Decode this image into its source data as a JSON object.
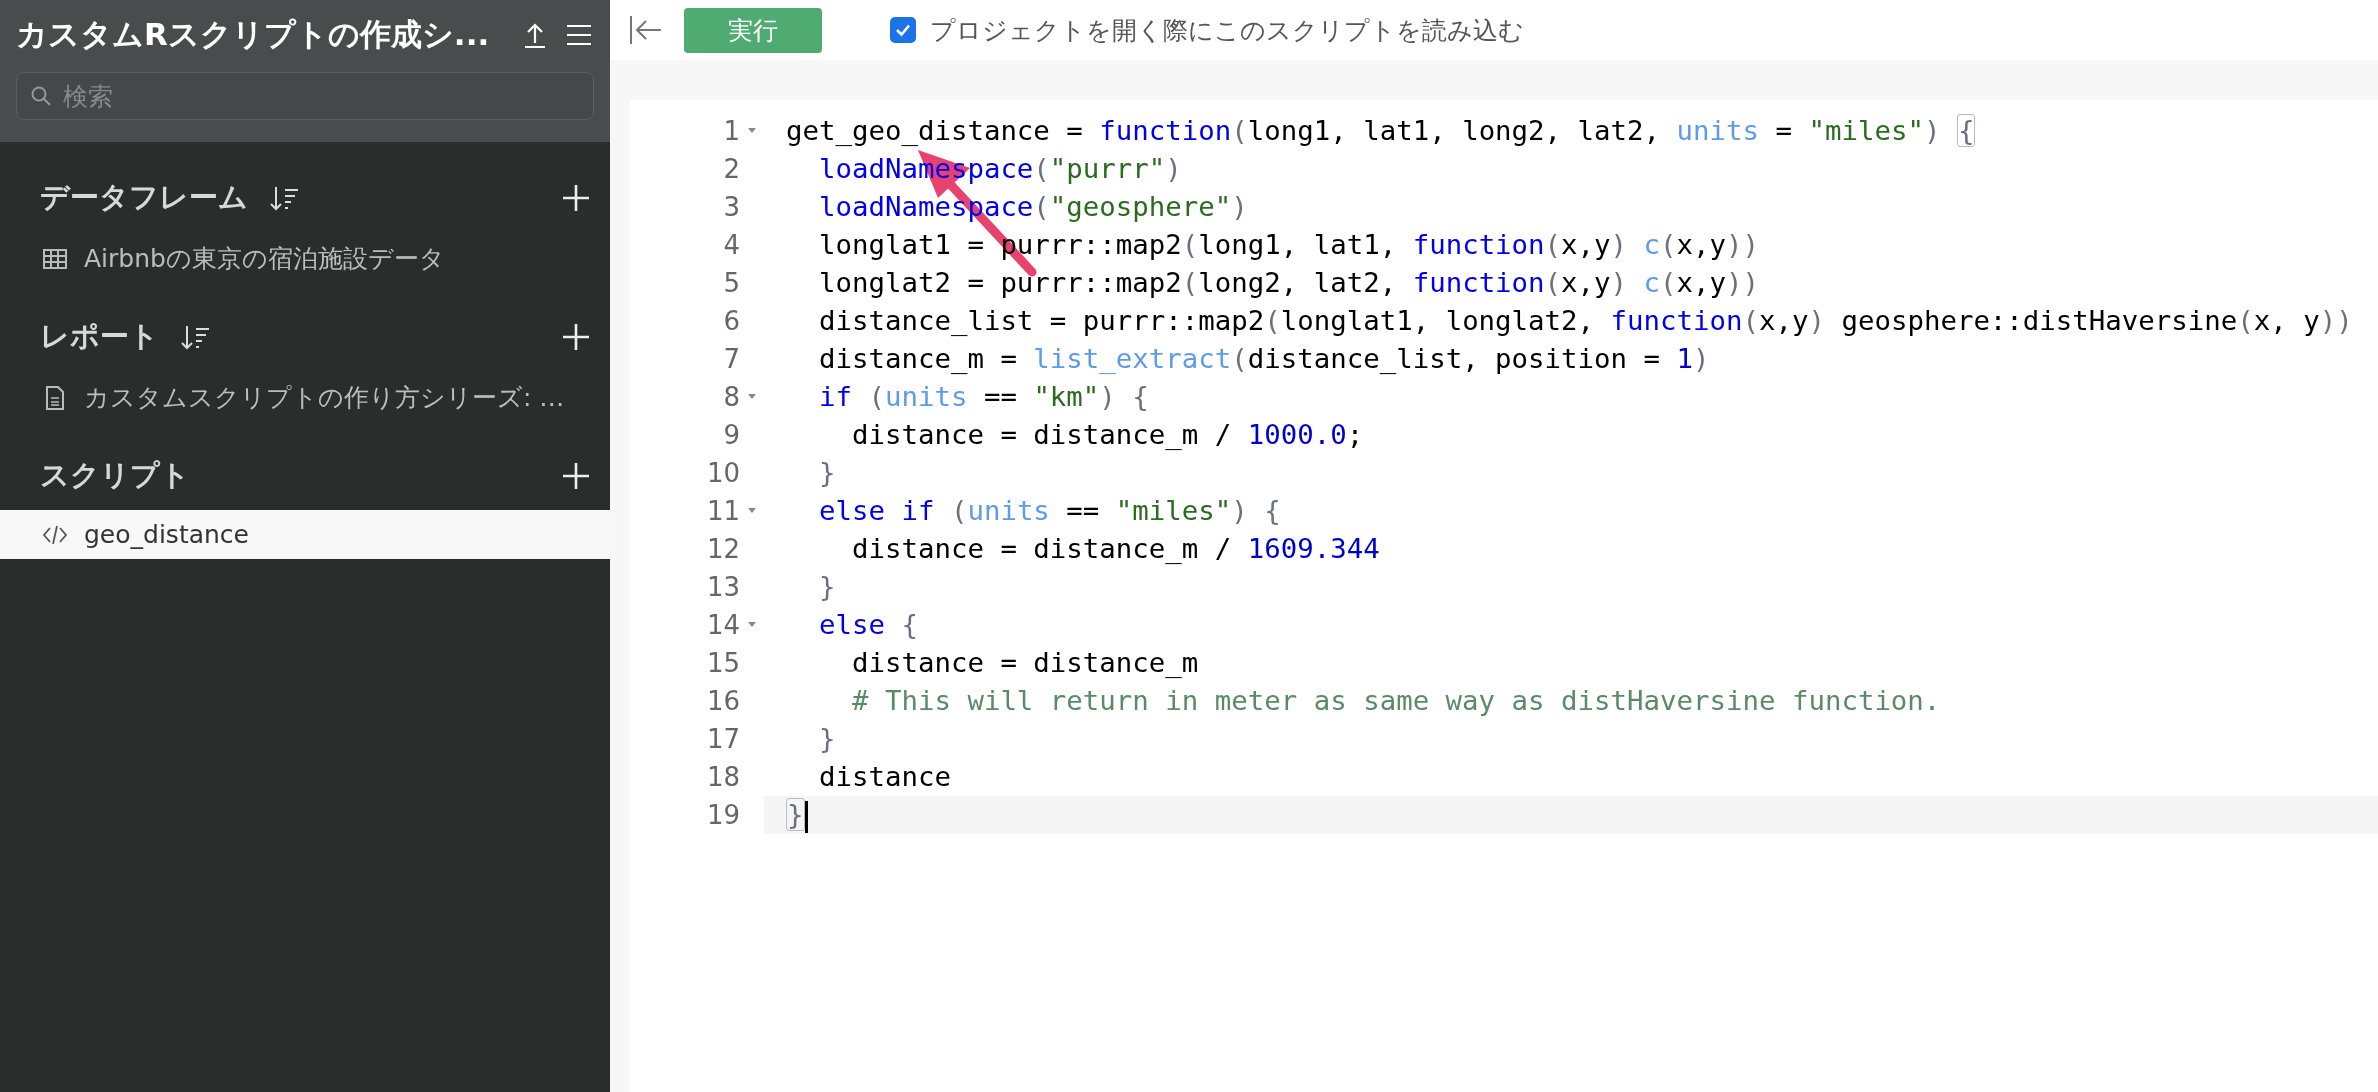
{
  "sidebar": {
    "title": "カスタムRスクリプトの作成シ...",
    "search": {
      "placeholder": "検索"
    },
    "sections": [
      {
        "title": "データフレーム",
        "sortable": true,
        "items": [
          {
            "kind": "table",
            "label": "Airbnbの東京の宿泊施設データ",
            "selected": false
          }
        ]
      },
      {
        "title": "レポート",
        "sortable": true,
        "items": [
          {
            "kind": "document",
            "label": "カスタムスクリプトの作り方シリーズ: …",
            "selected": false
          }
        ]
      },
      {
        "title": "スクリプト",
        "sortable": false,
        "items": [
          {
            "kind": "script",
            "label": "geo_distance",
            "selected": true
          }
        ]
      }
    ]
  },
  "toolbar": {
    "run_button": "実行",
    "load_on_open": {
      "label": "プロジェクトを開く際にこのスクリプトを読み込む",
      "checked": true
    }
  },
  "editor": {
    "lines": [
      {
        "number": "1",
        "fold": true,
        "active": false,
        "tokens": [
          {
            "kind": "plain",
            "text": "get_geo_distance = "
          },
          {
            "kind": "keyword",
            "text": "function"
          },
          {
            "kind": "paren",
            "text": "("
          },
          {
            "kind": "plain",
            "text": "long1, lat1, long2, lat2, "
          },
          {
            "kind": "name",
            "text": "units"
          },
          {
            "kind": "plain",
            "text": " = "
          },
          {
            "kind": "string",
            "text": "\"miles\""
          },
          {
            "kind": "paren",
            "text": ") "
          },
          {
            "kind": "match",
            "text": "{"
          }
        ]
      },
      {
        "number": "2",
        "fold": false,
        "active": false,
        "tokens": [
          {
            "kind": "keyword",
            "text": "  loadNamespace"
          },
          {
            "kind": "paren",
            "text": "("
          },
          {
            "kind": "string",
            "text": "\"purrr\""
          },
          {
            "kind": "paren",
            "text": ")"
          }
        ]
      },
      {
        "number": "3",
        "fold": false,
        "active": false,
        "tokens": [
          {
            "kind": "keyword",
            "text": "  loadNamespace"
          },
          {
            "kind": "paren",
            "text": "("
          },
          {
            "kind": "string",
            "text": "\"geosphere\""
          },
          {
            "kind": "paren",
            "text": ")"
          }
        ]
      },
      {
        "number": "4",
        "fold": false,
        "active": false,
        "tokens": [
          {
            "kind": "plain",
            "text": "  longlat1 = purrr::map2"
          },
          {
            "kind": "paren",
            "text": "("
          },
          {
            "kind": "plain",
            "text": "long1, lat1, "
          },
          {
            "kind": "keyword",
            "text": "function"
          },
          {
            "kind": "paren",
            "text": "("
          },
          {
            "kind": "plain",
            "text": "x,y"
          },
          {
            "kind": "paren",
            "text": ") "
          },
          {
            "kind": "name",
            "text": "c"
          },
          {
            "kind": "paren",
            "text": "("
          },
          {
            "kind": "plain",
            "text": "x,y"
          },
          {
            "kind": "paren",
            "text": "))"
          }
        ]
      },
      {
        "number": "5",
        "fold": false,
        "active": false,
        "tokens": [
          {
            "kind": "plain",
            "text": "  longlat2 = purrr::map2"
          },
          {
            "kind": "paren",
            "text": "("
          },
          {
            "kind": "plain",
            "text": "long2, lat2, "
          },
          {
            "kind": "keyword",
            "text": "function"
          },
          {
            "kind": "paren",
            "text": "("
          },
          {
            "kind": "plain",
            "text": "x,y"
          },
          {
            "kind": "paren",
            "text": ") "
          },
          {
            "kind": "name",
            "text": "c"
          },
          {
            "kind": "paren",
            "text": "("
          },
          {
            "kind": "plain",
            "text": "x,y"
          },
          {
            "kind": "paren",
            "text": "))"
          }
        ]
      },
      {
        "number": "6",
        "fold": false,
        "active": false,
        "tokens": [
          {
            "kind": "plain",
            "text": "  distance_list = purrr::map2"
          },
          {
            "kind": "paren",
            "text": "("
          },
          {
            "kind": "plain",
            "text": "longlat1, longlat2, "
          },
          {
            "kind": "keyword",
            "text": "function"
          },
          {
            "kind": "paren",
            "text": "("
          },
          {
            "kind": "plain",
            "text": "x,y"
          },
          {
            "kind": "paren",
            "text": ")"
          },
          {
            "kind": "plain",
            "text": " geosphere::distHaversine"
          },
          {
            "kind": "paren",
            "text": "("
          },
          {
            "kind": "plain",
            "text": "x, y"
          },
          {
            "kind": "paren",
            "text": "))"
          }
        ]
      },
      {
        "number": "7",
        "fold": false,
        "active": false,
        "tokens": [
          {
            "kind": "plain",
            "text": "  distance_m = "
          },
          {
            "kind": "name",
            "text": "list_extract"
          },
          {
            "kind": "paren",
            "text": "("
          },
          {
            "kind": "plain",
            "text": "distance_list, position = "
          },
          {
            "kind": "number",
            "text": "1"
          },
          {
            "kind": "paren",
            "text": ")"
          }
        ]
      },
      {
        "number": "8",
        "fold": true,
        "active": false,
        "tokens": [
          {
            "kind": "keyword",
            "text": "  if "
          },
          {
            "kind": "paren",
            "text": "("
          },
          {
            "kind": "name",
            "text": "units"
          },
          {
            "kind": "plain",
            "text": " == "
          },
          {
            "kind": "string",
            "text": "\"km\""
          },
          {
            "kind": "paren",
            "text": ") {"
          }
        ]
      },
      {
        "number": "9",
        "fold": false,
        "active": false,
        "tokens": [
          {
            "kind": "plain",
            "text": "    distance = distance_m / "
          },
          {
            "kind": "number",
            "text": "1000.0"
          },
          {
            "kind": "plain",
            "text": ";"
          }
        ]
      },
      {
        "number": "10",
        "fold": false,
        "active": false,
        "tokens": [
          {
            "kind": "paren",
            "text": "  }"
          }
        ]
      },
      {
        "number": "11",
        "fold": true,
        "active": false,
        "tokens": [
          {
            "kind": "keyword",
            "text": "  else if "
          },
          {
            "kind": "paren",
            "text": "("
          },
          {
            "kind": "name",
            "text": "units"
          },
          {
            "kind": "plain",
            "text": " == "
          },
          {
            "kind": "string",
            "text": "\"miles\""
          },
          {
            "kind": "paren",
            "text": ") {"
          }
        ]
      },
      {
        "number": "12",
        "fold": false,
        "active": false,
        "tokens": [
          {
            "kind": "plain",
            "text": "    distance = distance_m / "
          },
          {
            "kind": "number",
            "text": "1609.344"
          }
        ]
      },
      {
        "number": "13",
        "fold": false,
        "active": false,
        "tokens": [
          {
            "kind": "paren",
            "text": "  }"
          }
        ]
      },
      {
        "number": "14",
        "fold": true,
        "active": false,
        "tokens": [
          {
            "kind": "keyword",
            "text": "  else "
          },
          {
            "kind": "paren",
            "text": "{"
          }
        ]
      },
      {
        "number": "15",
        "fold": false,
        "active": false,
        "tokens": [
          {
            "kind": "plain",
            "text": "    distance = distance_m"
          }
        ]
      },
      {
        "number": "16",
        "fold": false,
        "active": false,
        "tokens": [
          {
            "kind": "comment",
            "text": "    # This will return in meter as same way as distHaversine function."
          }
        ]
      },
      {
        "number": "17",
        "fold": false,
        "active": false,
        "tokens": [
          {
            "kind": "paren",
            "text": "  }"
          }
        ]
      },
      {
        "number": "18",
        "fold": false,
        "active": false,
        "tokens": [
          {
            "kind": "plain",
            "text": "  distance"
          }
        ]
      },
      {
        "number": "19",
        "fold": false,
        "active": true,
        "tokens": [
          {
            "kind": "match",
            "text": "}"
          }
        ]
      }
    ]
  }
}
